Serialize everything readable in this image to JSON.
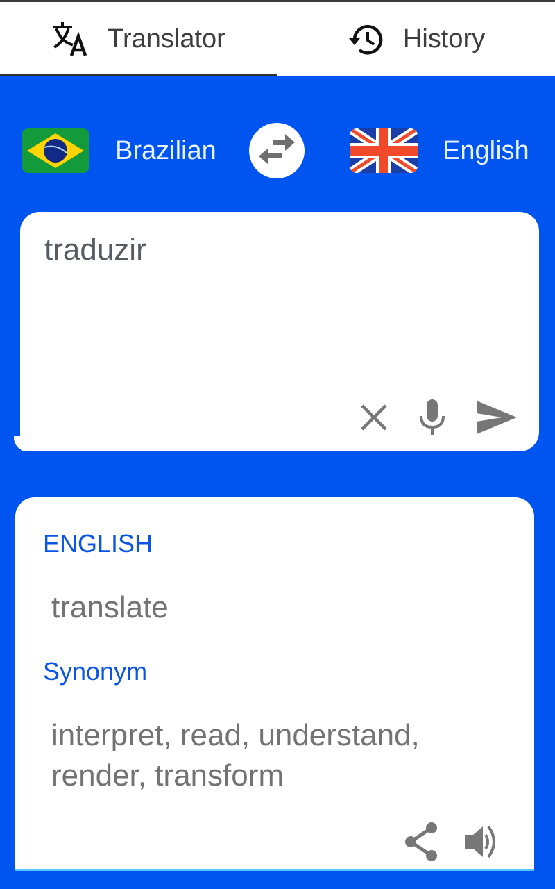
{
  "tabs": [
    {
      "label": "Translator",
      "icon": "translate-icon",
      "active": true
    },
    {
      "label": "History",
      "icon": "history-icon",
      "active": false
    }
  ],
  "languages": {
    "source": {
      "label": "Brazilian",
      "flag": "brazil-flag"
    },
    "target": {
      "label": "English",
      "flag": "uk-flag"
    },
    "swap_icon": "swap-arrows-icon"
  },
  "input": {
    "text": "traduzir",
    "actions": [
      "clear-icon",
      "microphone-icon",
      "send-icon"
    ]
  },
  "output": {
    "language_heading": "ENGLISH",
    "translation": "translate",
    "synonym_heading": "Synonym",
    "synonyms": "interpret, read, understand, render, transform",
    "actions": [
      "share-icon",
      "speaker-icon"
    ]
  },
  "colors": {
    "background": "#0054f0",
    "heading": "#0a54e6",
    "text": "#737373",
    "icon": "#777777"
  }
}
